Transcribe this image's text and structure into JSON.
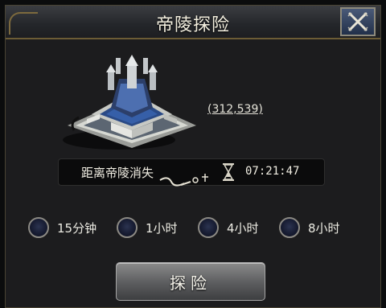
{
  "window": {
    "title": "帝陵探险",
    "close_icon": "close-x-icon",
    "accent": "#7d6a3d"
  },
  "tomb": {
    "coordinates": "(312,539)"
  },
  "timer": {
    "label": "距离帝陵消失",
    "value": "07:21:47",
    "icon": "hourglass-icon"
  },
  "durations": [
    {
      "label": "15分钟"
    },
    {
      "label": "1小时"
    },
    {
      "label": "4小时"
    },
    {
      "label": "8小时"
    }
  ],
  "action": {
    "explore_label": "探险"
  }
}
